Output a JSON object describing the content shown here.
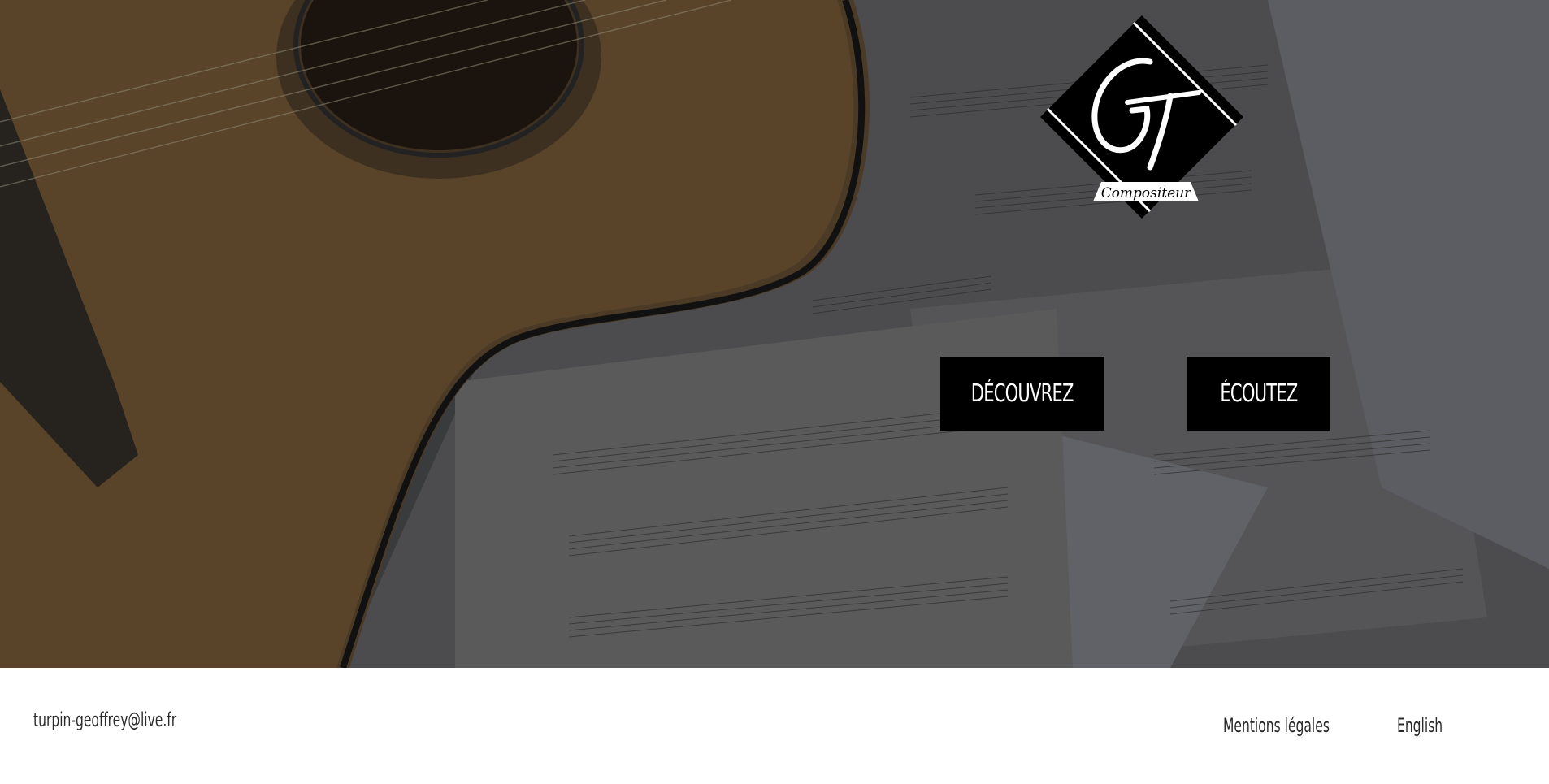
{
  "hero": {
    "logo": {
      "monogram": "GT",
      "caption": "Compositeur"
    },
    "buttons": {
      "discover_label": "Découvrez",
      "listen_label": "Écoutez"
    }
  },
  "footer": {
    "email": "turpin-geoffrey@live.fr",
    "legal_label": "Mentions légales",
    "language_label": "English"
  },
  "colors": {
    "button_bg": "#000000",
    "button_text": "#ffffff",
    "footer_bg": "#ffffff",
    "footer_text": "#2a2a2a",
    "hero_overlay": "#2b2c2e"
  }
}
